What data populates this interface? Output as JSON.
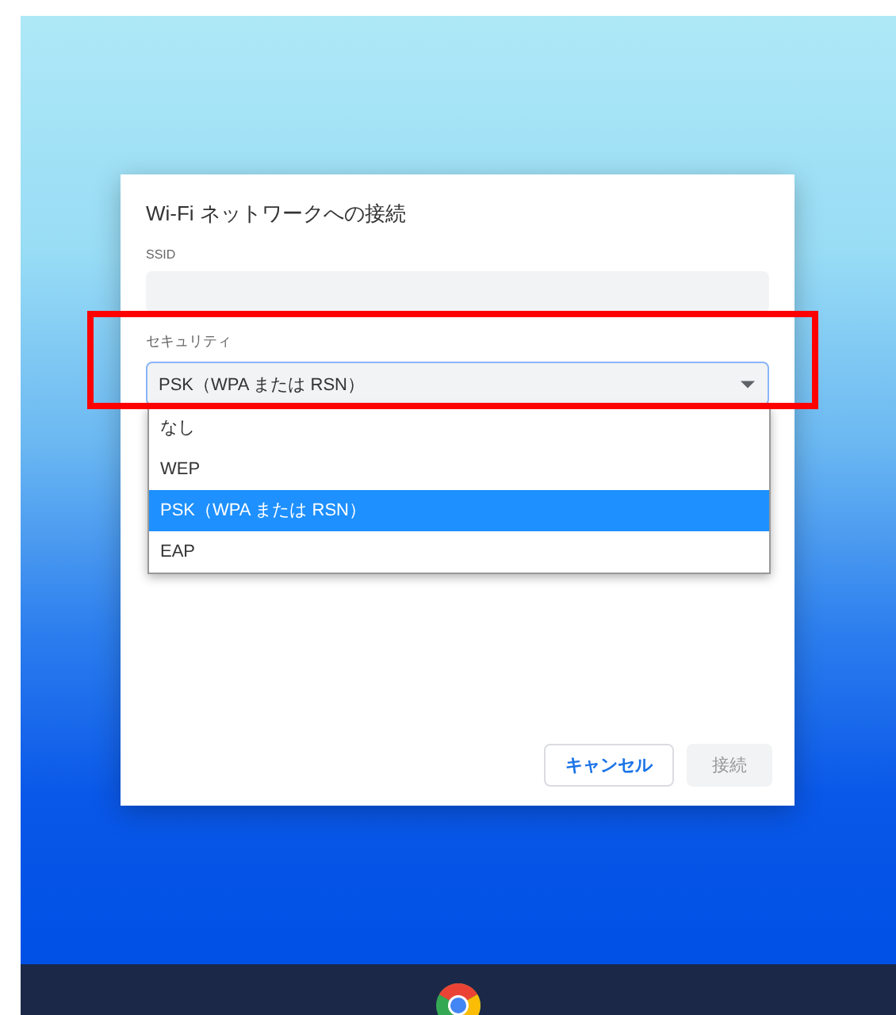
{
  "dialog": {
    "title": "Wi-Fi ネットワークへの接続",
    "ssid": {
      "label": "SSID"
    },
    "security": {
      "label": "セキュリティ",
      "value": "PSK（WPA または RSN）",
      "expanded": true,
      "options": [
        {
          "label": "なし",
          "selected": false
        },
        {
          "label": "WEP",
          "selected": false
        },
        {
          "label": "PSK（WPA または RSN）",
          "selected": true
        },
        {
          "label": "EAP",
          "selected": false
        }
      ]
    },
    "buttons": [
      {
        "label": "キャンセル",
        "kind": "secondary",
        "disabled": false
      },
      {
        "label": "接続",
        "kind": "primary",
        "disabled": true
      }
    ]
  },
  "annotation": {
    "kind": "highlight-box"
  }
}
